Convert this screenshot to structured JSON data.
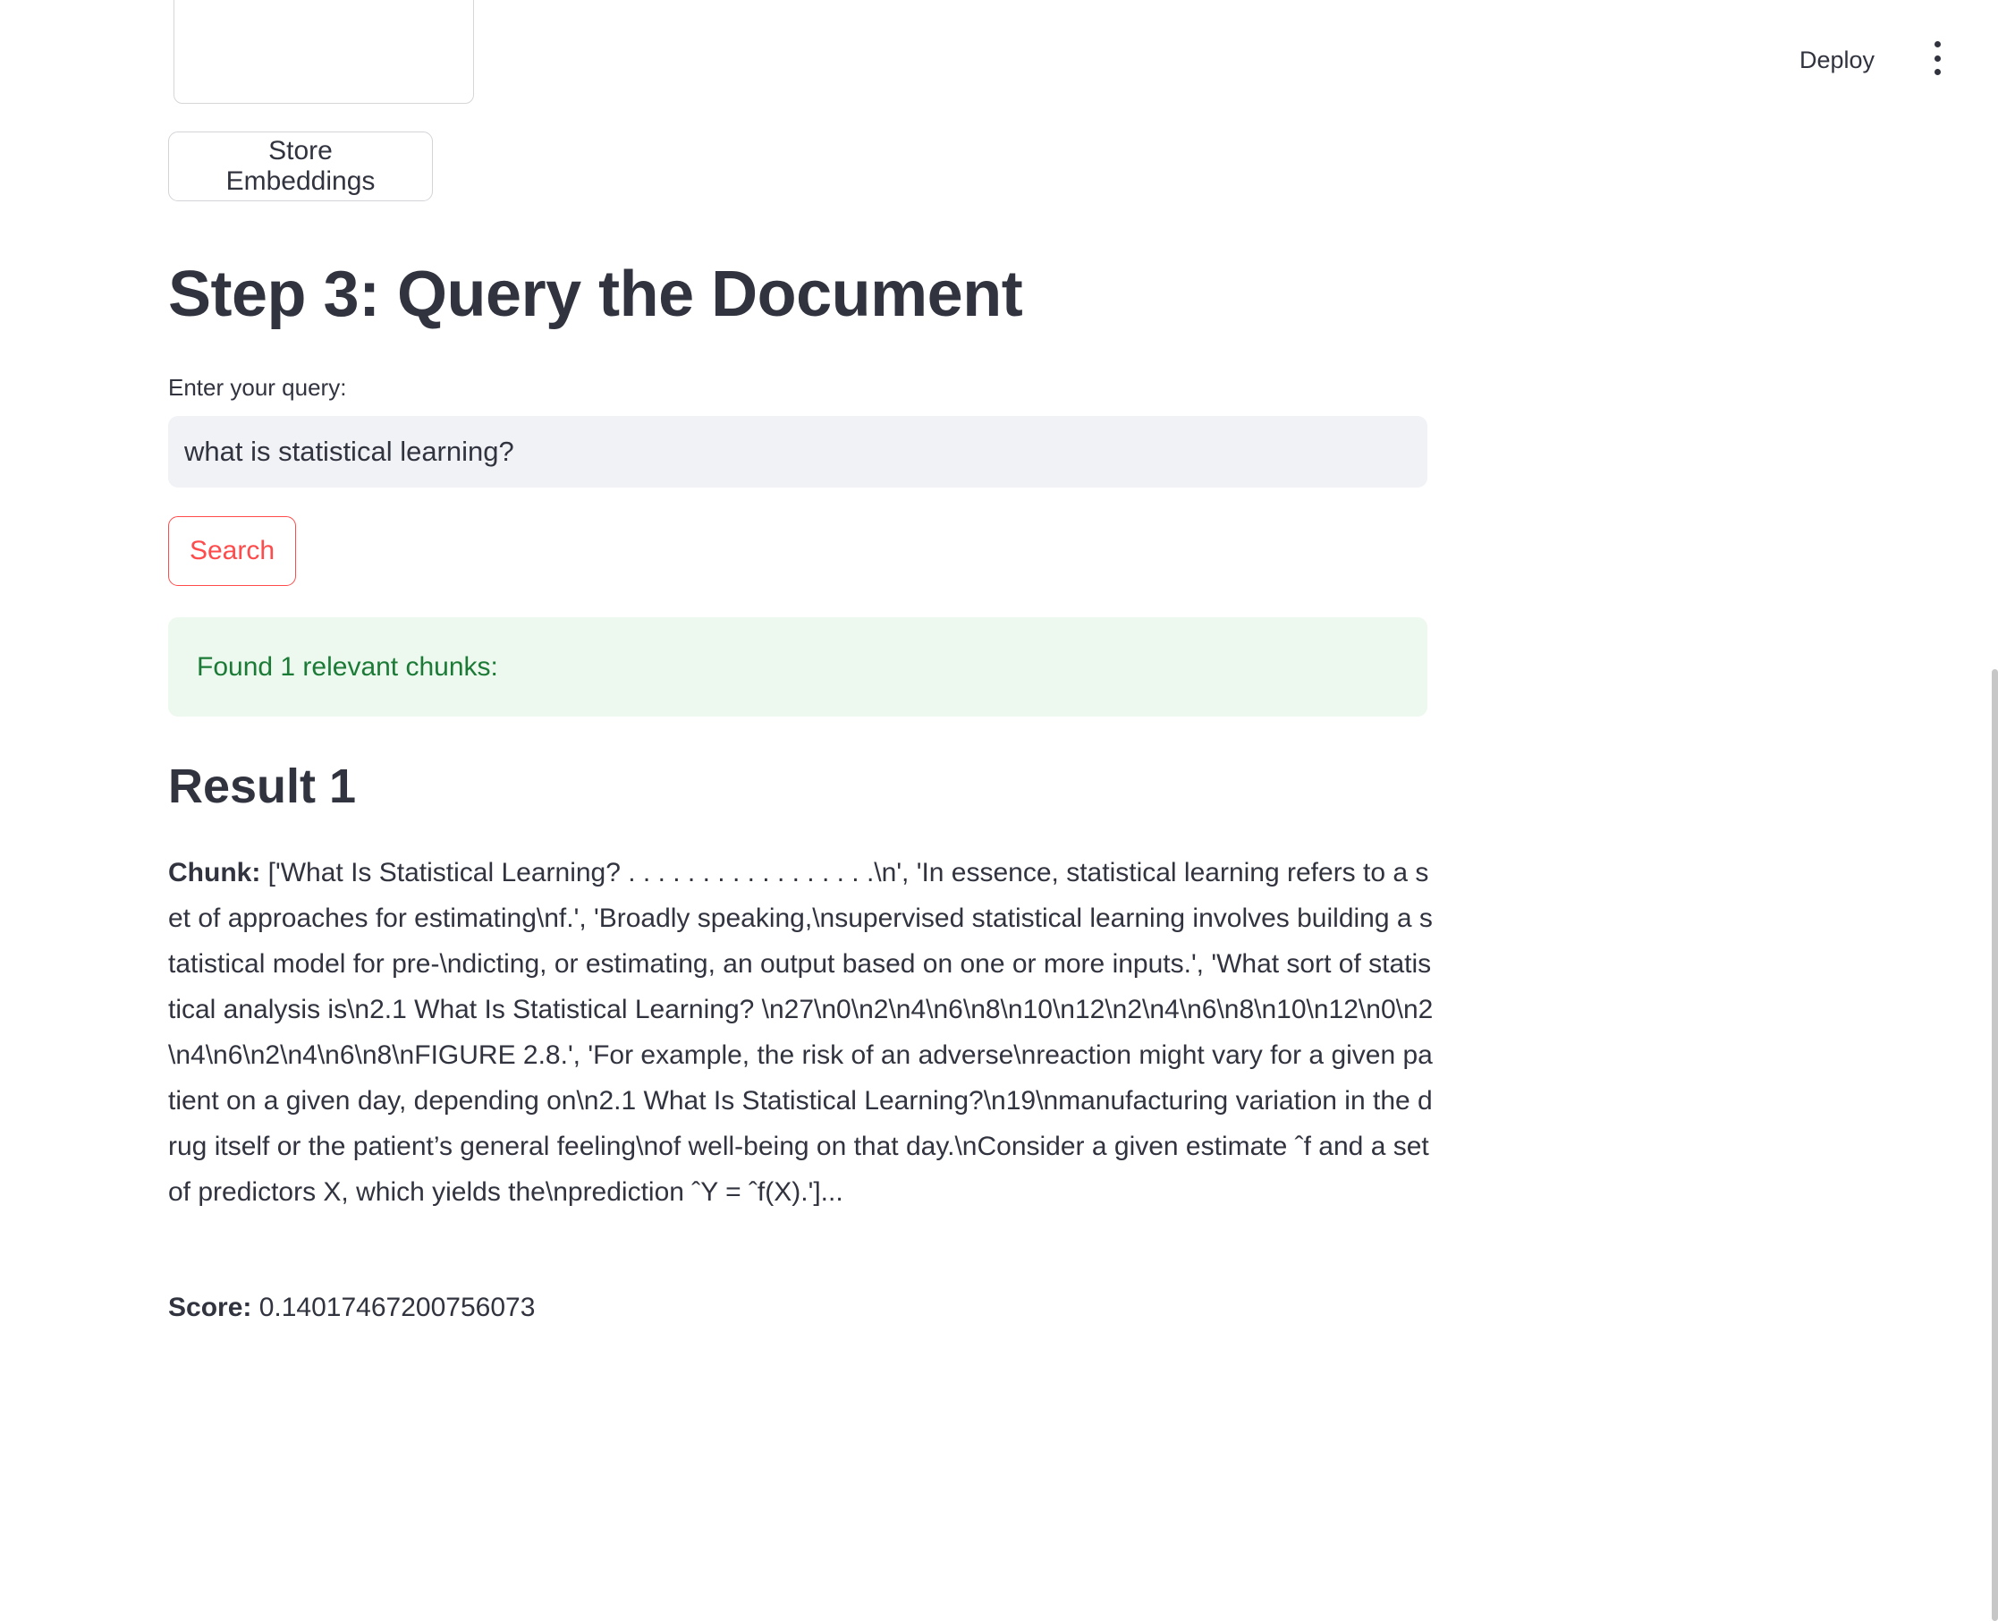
{
  "header": {
    "deploy_label": "Deploy",
    "menu_icon": "more-vertical-icon"
  },
  "actions": {
    "store_embeddings_label": "Store Embeddings"
  },
  "query_section": {
    "title": "Step 3: Query the Document",
    "input_label": "Enter your query:",
    "input_value": "what is statistical learning?",
    "search_label": "Search"
  },
  "status": {
    "message": "Found 1 relevant chunks:",
    "color": "#1b7a36",
    "background": "#edf8ee"
  },
  "results": [
    {
      "title": "Result 1",
      "chunk_label": "Chunk:",
      "chunk_text": "['What Is Statistical Learning? . . . . . . . . . . . . . . . . .\\n', 'In essence, statistical learning refers to a set of approaches for estimating\\nf.', 'Broadly speaking,\\nsupervised statistical learning involves building a statistical model for pre-\\ndicting, or estimating, an output based on one or more inputs.', 'What sort of statistical analysis is\\n2.1 What Is Statistical Learning? \\n27\\n0\\n2\\n4\\n6\\n8\\n10\\n12\\n2\\n4\\n6\\n8\\n10\\n12\\n0\\n2\\n4\\n6\\n2\\n4\\n6\\n8\\nFIGURE 2.8.', 'For example, the risk of an adverse\\nreaction might vary for a given patient on a given day, depending on\\n2.1 What Is Statistical Learning?\\n19\\nmanufacturing variation in the drug itself or the patient’s general feeling\\nof well-being on that day.\\nConsider a given estimate ˆf and a set of predictors X, which yields the\\nprediction ˆY = ˆf(X).']...",
      "score_label": "Score:",
      "score_value": "0.14017467200756073"
    }
  ],
  "colors": {
    "primary": "#ff4b4b",
    "text": "#31333f",
    "input_bg": "#f0f2f6"
  }
}
